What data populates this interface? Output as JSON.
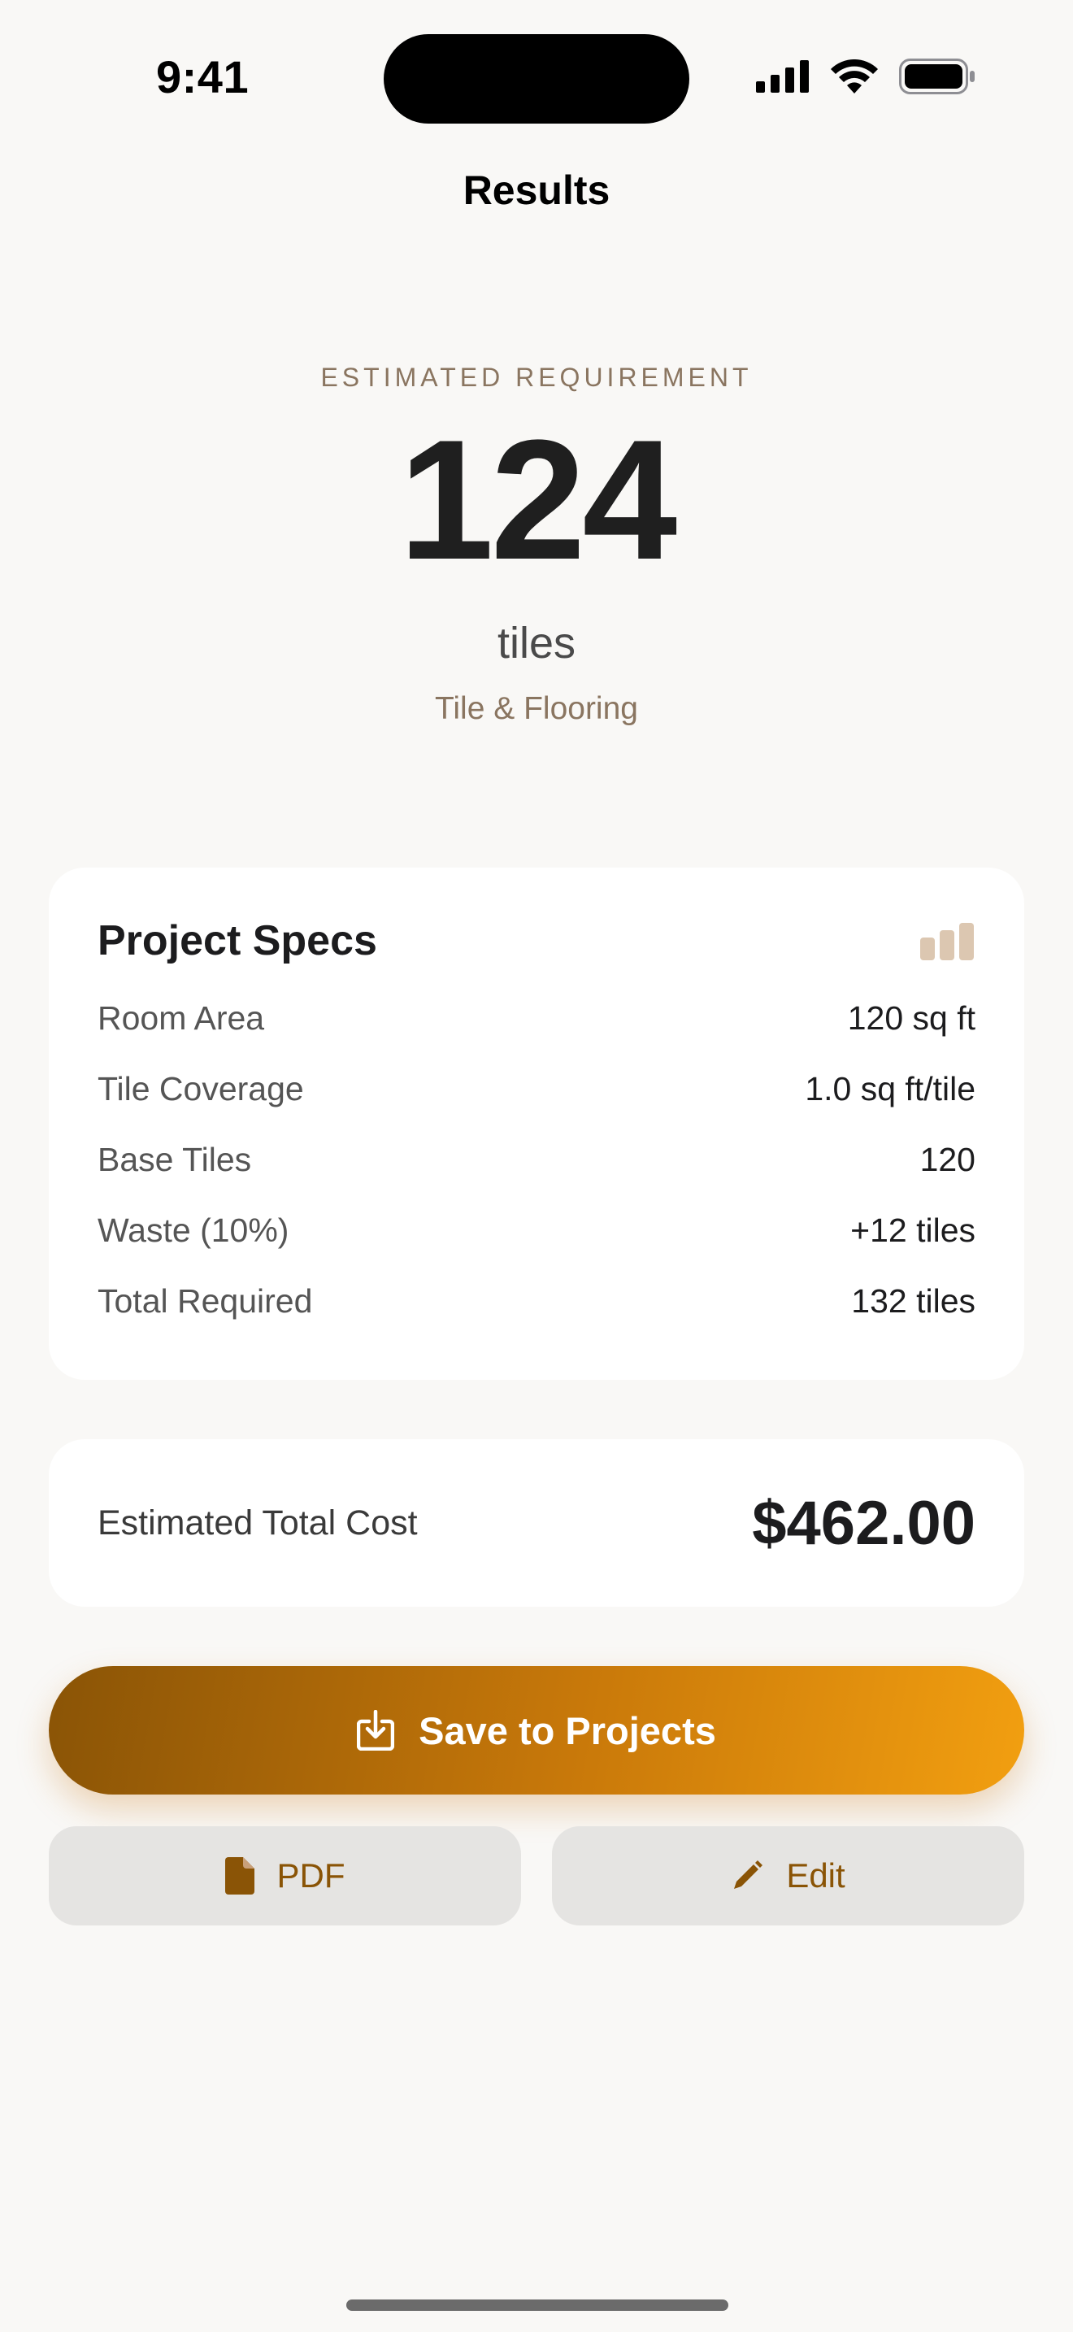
{
  "status_bar": {
    "time": "9:41"
  },
  "nav": {
    "title": "Results"
  },
  "hero": {
    "eyebrow": "ESTIMATED REQUIREMENT",
    "count": "124",
    "unit": "tiles",
    "category": "Tile & Flooring"
  },
  "specs": {
    "title": "Project Specs",
    "icon": "bar-chart-icon",
    "rows": [
      {
        "label": "Room Area",
        "value": "120 sq ft"
      },
      {
        "label": "Tile Coverage",
        "value": "1.0 sq ft/tile"
      },
      {
        "label": "Base Tiles",
        "value": "120"
      },
      {
        "label": "Waste (10%)",
        "value": "+12 tiles"
      },
      {
        "label": "Total Required",
        "value": "132 tiles"
      }
    ]
  },
  "cost": {
    "label": "Estimated Total Cost",
    "value": "$462.00"
  },
  "actions": {
    "save_label": "Save to Projects",
    "pdf_label": "PDF",
    "edit_label": "Edit"
  },
  "colors": {
    "accent": "#c9790a",
    "accent_dark": "#8a5406",
    "accent_light": "#f29f10",
    "background": "#f9f8f6",
    "muted_brown": "#8a7560"
  }
}
